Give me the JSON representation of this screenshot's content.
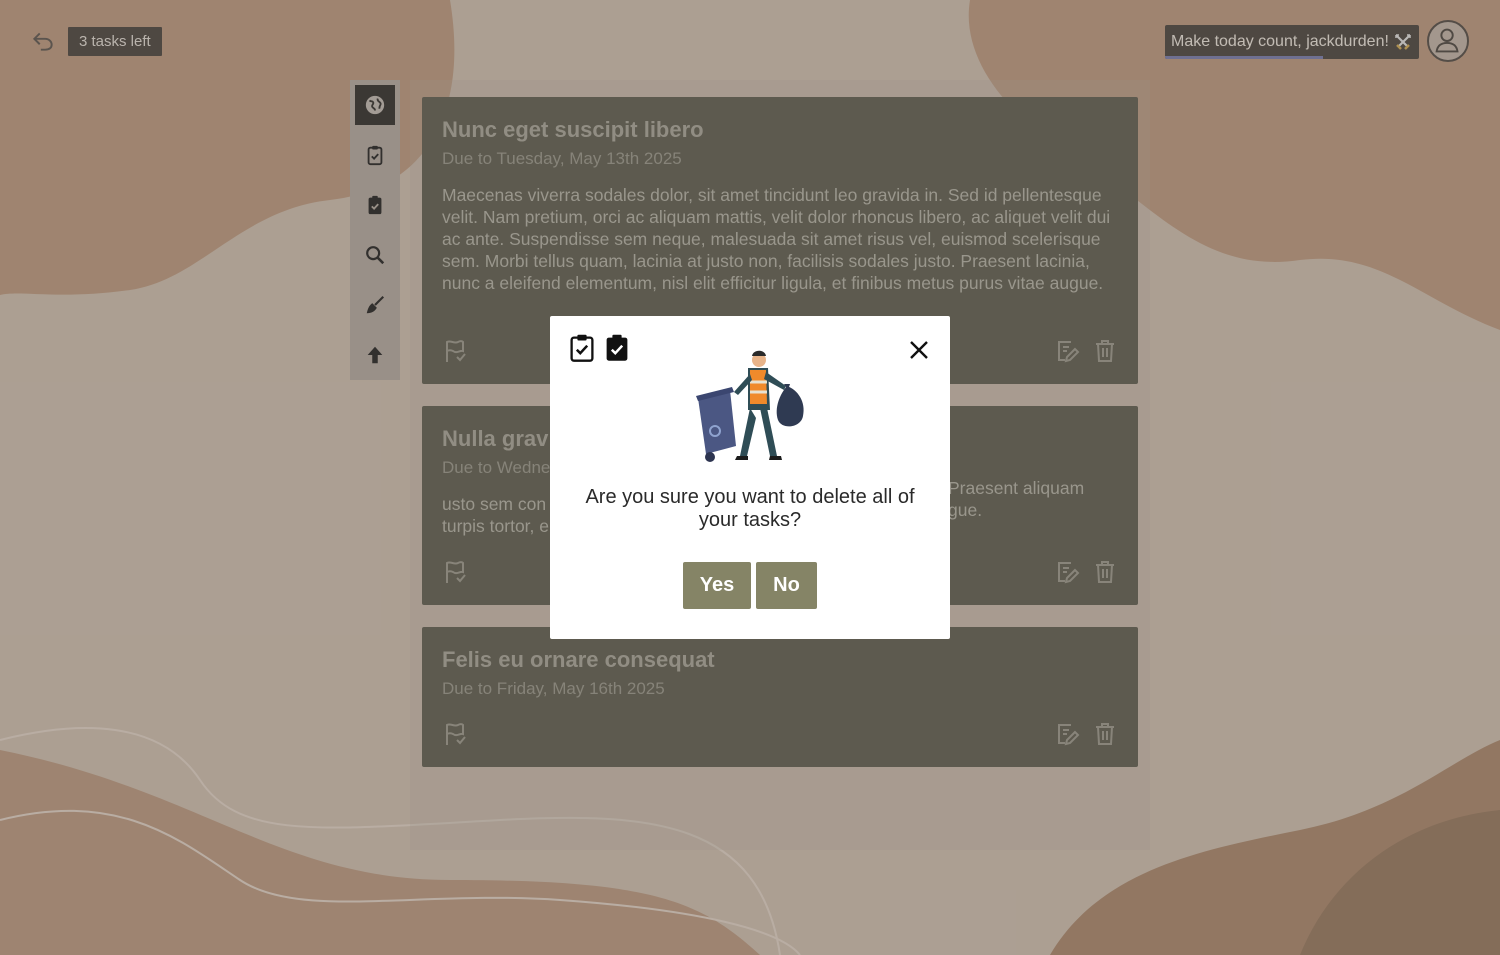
{
  "header": {
    "tasks_left": "3 tasks left",
    "greeting": "Make today count, jackdurden!",
    "greeting_emoji": "swords-icon"
  },
  "toolbar": {
    "items": [
      {
        "name": "globe-icon",
        "active": true
      },
      {
        "name": "clipboard-check-outline-icon"
      },
      {
        "name": "clipboard-check-filled-icon"
      },
      {
        "name": "search-icon"
      },
      {
        "name": "broom-icon"
      },
      {
        "name": "arrow-up-icon"
      }
    ]
  },
  "tasks": [
    {
      "title": "Nunc eget suscipit libero",
      "due": "Due to Tuesday, May 13th 2025",
      "description": "Maecenas viverra sodales dolor, sit amet tincidunt leo gravida in. Sed id pellentesque velit. Nam pretium, orci ac aliquam mattis, velit dolor rhoncus libero, ac aliquet velit dui ac ante. Suspendisse sem neque, malesuada sit amet risus vel, euismod scelerisque sem. Morbi tellus quam, lacinia at justo non, facilisis sodales justo. Praesent lacinia, nunc a eleifend elementum, nisl elit efficitur ligula, et finibus metus purus vitae augue."
    },
    {
      "title": "Nulla grav",
      "due": "Due to Wedne",
      "description_left": "usto sem con\nturpis tortor, e",
      "description_right": "Praesent aliquam\ngue."
    },
    {
      "title": "Felis eu ornare consequat",
      "due": "Due to Friday, May 16th 2025",
      "description": ""
    }
  ],
  "modal": {
    "message": "Are you sure you want to delete all of your tasks?",
    "yes_label": "Yes",
    "no_label": "No",
    "illustration": "trash-collector-illustration"
  },
  "colors": {
    "card_bg": "#504f41",
    "button_bg": "#858466",
    "accent_bar": "#6a6fa3"
  }
}
